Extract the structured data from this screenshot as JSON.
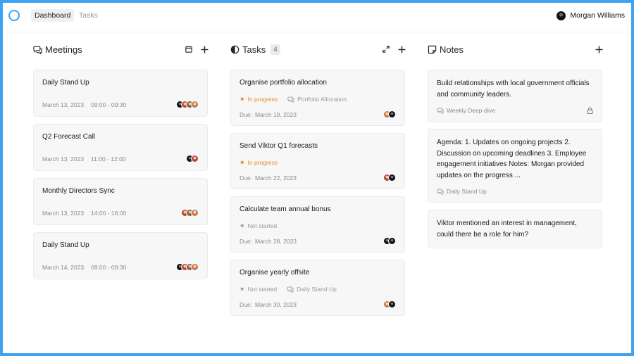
{
  "nav": {
    "tabs": [
      {
        "label": "Dashboard",
        "active": true
      },
      {
        "label": "Tasks",
        "active": false
      }
    ],
    "user_name": "Morgan Williams"
  },
  "meetings": {
    "title": "Meetings",
    "items": [
      {
        "title": "Daily Stand Up",
        "date": "March 13, 2023",
        "time": "09:00 - 09:30",
        "avatars": 4
      },
      {
        "title": "Q2 Forecast Call",
        "date": "March 13, 2023",
        "time": "11:00 - 12:00",
        "avatars": 2
      },
      {
        "title": "Monthly Directors Sync",
        "date": "March 13, 2023",
        "time": "14:00 - 16:00",
        "avatars": 3
      },
      {
        "title": "Daily Stand Up",
        "date": "March 14, 2023",
        "time": "09:00 - 09:30",
        "avatars": 4
      }
    ]
  },
  "tasks": {
    "title": "Tasks",
    "count": "4",
    "items": [
      {
        "title": "Organise portfolio allocation",
        "status": "In progress",
        "linked": "Portfolio Allocation",
        "due_label": "Due:",
        "due": "March 19, 2023"
      },
      {
        "title": "Send Viktor Q1 forecasts",
        "status": "In progress",
        "linked": "",
        "due_label": "Due:",
        "due": "March 22, 2023"
      },
      {
        "title": "Calculate team annual bonus",
        "status": "Not started",
        "linked": "",
        "due_label": "Due:",
        "due": "March 28, 2023"
      },
      {
        "title": "Organise yearly offsite",
        "status": "Not started",
        "linked": "Daily Stand Up",
        "due_label": "Due:",
        "due": "March 30, 2023"
      }
    ]
  },
  "notes": {
    "title": "Notes",
    "items": [
      {
        "text": "Build relationships with local government officials and community leaders.",
        "source": "Weekly Deep-dive",
        "locked": true
      },
      {
        "text": "Agenda: 1. Updates on ongoing projects 2. Discussion on upcoming deadlines 3. Employee engagement initiatives Notes: Morgan provided updates on the progress ...",
        "source": "Daily Stand Up",
        "locked": false
      },
      {
        "text": "Viktor mentioned an interest in management, could there be a role for him?",
        "source": "",
        "locked": false
      }
    ]
  },
  "colors": {
    "accent": "#3fa2f2",
    "in_progress": "#e58a1f",
    "not_started": "#999999"
  },
  "icons": {
    "logo": "ring-logo-icon",
    "meetings": "chat-bubbles-icon",
    "tasks": "half-circle-icon",
    "notes": "note-icon",
    "calendar": "calendar-icon",
    "add": "plus-icon",
    "expand": "expand-icon",
    "lock": "lock-icon"
  }
}
